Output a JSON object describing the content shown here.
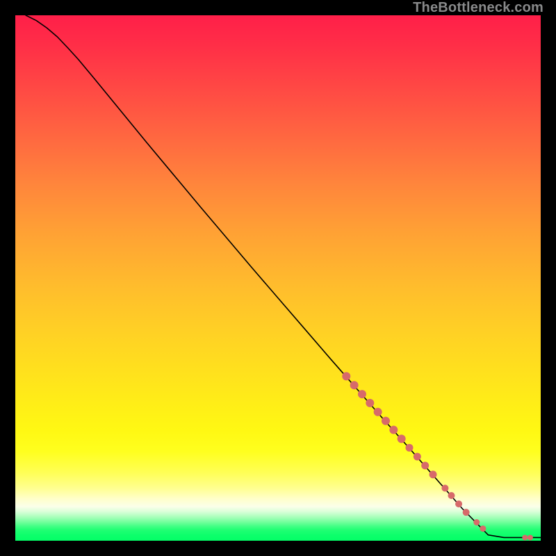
{
  "watermark": "TheBottleneck.com",
  "colors": {
    "curve": "#000000",
    "markers": "#d76a6a",
    "gradient_top": "#ff1f49",
    "gradient_bottom": "#04ff67"
  },
  "chart_data": {
    "type": "line",
    "title": "",
    "xlabel": "",
    "ylabel": "",
    "xlim": [
      0,
      100
    ],
    "ylim": [
      0,
      100
    ],
    "grid": false,
    "curve": {
      "x": [
        2,
        4,
        6,
        8,
        10,
        12,
        15,
        20,
        25,
        30,
        35,
        40,
        45,
        50,
        55,
        60,
        65,
        70,
        75,
        80,
        85,
        90,
        93,
        95,
        97,
        98,
        99,
        100
      ],
      "y": [
        100,
        99.0,
        97.6,
        95.9,
        93.8,
        91.6,
        88.0,
        81.9,
        75.8,
        69.8,
        63.8,
        57.9,
        52.0,
        46.2,
        40.4,
        34.6,
        28.9,
        23.2,
        17.6,
        11.9,
        6.2,
        1.1,
        0.6,
        0.6,
        0.6,
        0.6,
        0.6,
        0.6
      ]
    },
    "markers": {
      "color": "#d76a6a",
      "points": [
        {
          "x": 63.0,
          "y": 31.3,
          "r": 6
        },
        {
          "x": 64.5,
          "y": 29.6,
          "r": 6
        },
        {
          "x": 66.0,
          "y": 27.9,
          "r": 6
        },
        {
          "x": 67.5,
          "y": 26.2,
          "r": 6
        },
        {
          "x": 69.0,
          "y": 24.5,
          "r": 6
        },
        {
          "x": 70.5,
          "y": 22.8,
          "r": 6
        },
        {
          "x": 72.0,
          "y": 21.1,
          "r": 6
        },
        {
          "x": 73.5,
          "y": 19.4,
          "r": 6
        },
        {
          "x": 75.0,
          "y": 17.7,
          "r": 5.5
        },
        {
          "x": 76.5,
          "y": 16.0,
          "r": 5.5
        },
        {
          "x": 78.0,
          "y": 14.3,
          "r": 5.5
        },
        {
          "x": 79.5,
          "y": 12.6,
          "r": 5.5
        },
        {
          "x": 81.8,
          "y": 10.0,
          "r": 5
        },
        {
          "x": 83.0,
          "y": 8.6,
          "r": 5
        },
        {
          "x": 84.4,
          "y": 7.0,
          "r": 5
        },
        {
          "x": 85.8,
          "y": 5.4,
          "r": 5
        },
        {
          "x": 87.8,
          "y": 3.5,
          "r": 4.5
        },
        {
          "x": 89.0,
          "y": 2.3,
          "r": 4.5
        },
        {
          "x": 97.0,
          "y": 0.6,
          "r": 4
        },
        {
          "x": 98.0,
          "y": 0.6,
          "r": 4
        }
      ]
    }
  }
}
